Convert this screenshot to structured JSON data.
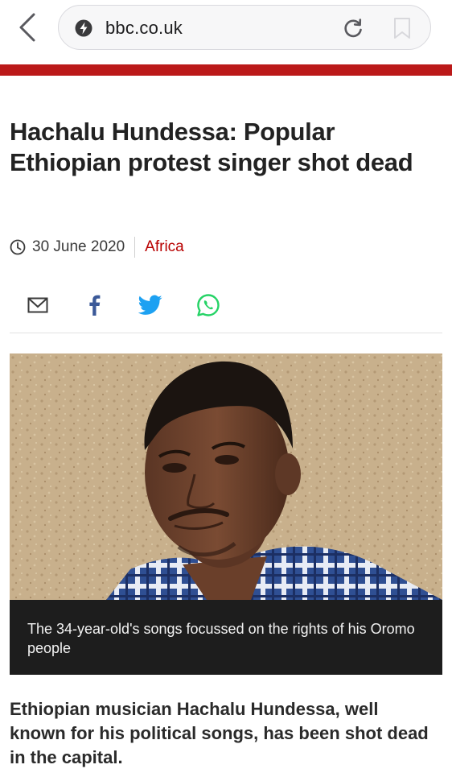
{
  "browser": {
    "url": "bbc.co.uk",
    "back_icon": "chevron-left-icon",
    "site_icon": "bolt-icon",
    "reload_icon": "reload-icon",
    "bookmark_icon": "bookmark-icon"
  },
  "brand": {
    "bar_color": "#bb1919"
  },
  "article": {
    "headline": "Hachalu Hundessa: Popular Ethiopian protest singer shot dead",
    "date": "30 June 2020",
    "section": "Africa",
    "section_color": "#b80000",
    "share": [
      {
        "name": "email",
        "icon": "email-icon"
      },
      {
        "name": "facebook",
        "icon": "facebook-icon",
        "color": "#3b5998"
      },
      {
        "name": "twitter",
        "icon": "twitter-icon",
        "color": "#1da1f2"
      },
      {
        "name": "whatsapp",
        "icon": "whatsapp-icon",
        "color": "#25d366"
      }
    ],
    "image_caption": "The 34-year-old's songs focussed on the rights of his Oromo people",
    "summary": "Ethiopian musician Hachalu Hundessa, well known for his political songs, has been shot dead in the capital."
  }
}
